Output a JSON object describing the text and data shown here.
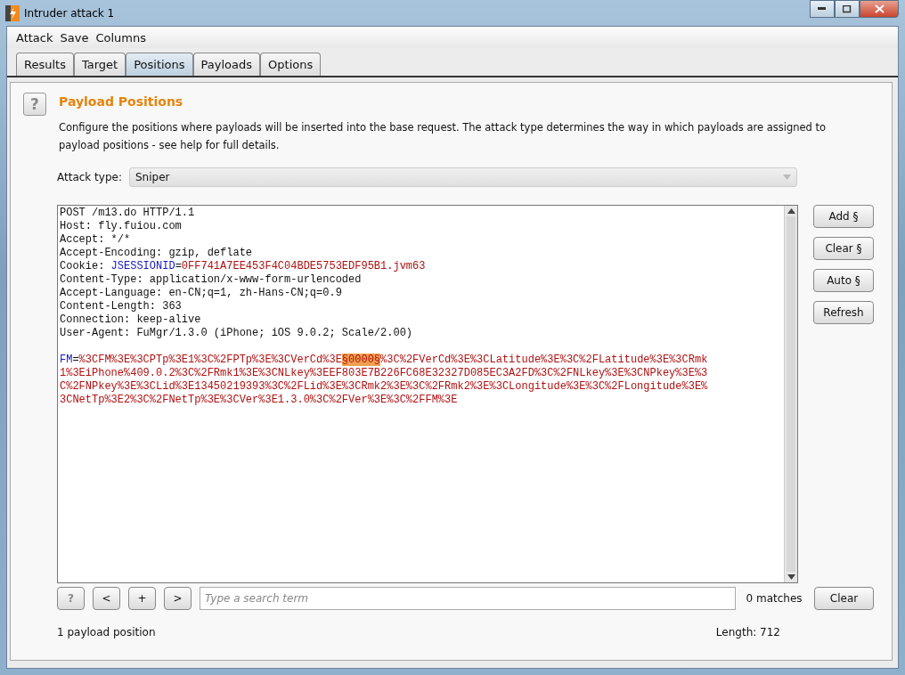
{
  "window": {
    "title": "Intruder attack 1"
  },
  "menu": [
    "Attack",
    "Save",
    "Columns"
  ],
  "tabs": [
    {
      "label": "Results",
      "selected": false
    },
    {
      "label": "Target",
      "selected": false
    },
    {
      "label": "Positions",
      "selected": true
    },
    {
      "label": "Payloads",
      "selected": false
    },
    {
      "label": "Options",
      "selected": false
    }
  ],
  "section": {
    "help": "?",
    "title": "Payload Positions",
    "description": "Configure the positions where payloads will be inserted into the base request. The attack type determines the way in which payloads are assigned to payload positions - see help for full details."
  },
  "attack_type": {
    "label": "Attack type:",
    "value": "Sniper"
  },
  "request": {
    "headers": [
      [
        {
          "kind": "plain",
          "text": "POST /m13.do HTTP/1.1"
        }
      ],
      [
        {
          "kind": "plain",
          "text": "Host: fly.fuiou.com"
        }
      ],
      [
        {
          "kind": "plain",
          "text": "Accept: */*"
        }
      ],
      [
        {
          "kind": "plain",
          "text": "Accept-Encoding: gzip, deflate"
        }
      ],
      [
        {
          "kind": "plain",
          "text": "Cookie: "
        },
        {
          "kind": "name",
          "text": "JSESSIONID"
        },
        {
          "kind": "plain",
          "text": "="
        },
        {
          "kind": "value",
          "text": "0FF741A7EE453F4C04BDE5753EDF95B1.jvm63"
        }
      ],
      [
        {
          "kind": "plain",
          "text": "Content-Type: application/x-www-form-urlencoded"
        }
      ],
      [
        {
          "kind": "plain",
          "text": "Accept-Language: en-CN;q=1, zh-Hans-CN;q=0.9"
        }
      ],
      [
        {
          "kind": "plain",
          "text": "Content-Length: 363"
        }
      ],
      [
        {
          "kind": "plain",
          "text": "Connection: keep-alive"
        }
      ],
      [
        {
          "kind": "plain",
          "text": "User-Agent: FuMgr/1.3.0 (iPhone; iOS 9.0.2; Scale/2.00)"
        }
      ]
    ],
    "body": [
      [
        {
          "kind": "name",
          "text": "FM"
        },
        {
          "kind": "plain",
          "text": "="
        },
        {
          "kind": "value",
          "text": "%3CFM%3E%3CPTp%3E1%3C%2FPTp%3E%3CVerCd%3E"
        },
        {
          "kind": "marker",
          "text": "§0000§"
        },
        {
          "kind": "value",
          "text": "%3C%2FVerCd%3E%3CLatitude%3E%3C%2FLatitude%3E%3CRmk"
        }
      ],
      [
        {
          "kind": "value",
          "text": "1%3EiPhone%409.0.2%3C%2FRmk1%3E%3CNLkey%3EEF803E7B226FC68E32327D085EC3A2FD%3C%2FNLkey%3E%3CNPkey%3E%3"
        }
      ],
      [
        {
          "kind": "value",
          "text": "C%2FNPkey%3E%3CLid%3E13450219393%3C%2FLid%3E%3CRmk2%3E%3C%2FRmk2%3E%3CLongitude%3E%3C%2FLongitude%3E%"
        }
      ],
      [
        {
          "kind": "value",
          "text": "3CNetTp%3E2%3C%2FNetTp%3E%3CVer%3E1.3.0%3C%2FVer%3E%3C%2FFM%3E"
        }
      ]
    ]
  },
  "side_buttons": [
    "Add §",
    "Clear §",
    "Auto §",
    "Refresh"
  ],
  "search": {
    "nav_buttons": [
      "?",
      "<",
      "+",
      ">"
    ],
    "placeholder": "Type a search term",
    "matches": "0 matches",
    "clear": "Clear"
  },
  "status": {
    "positions": "1 payload position",
    "length": "Length: 712"
  }
}
